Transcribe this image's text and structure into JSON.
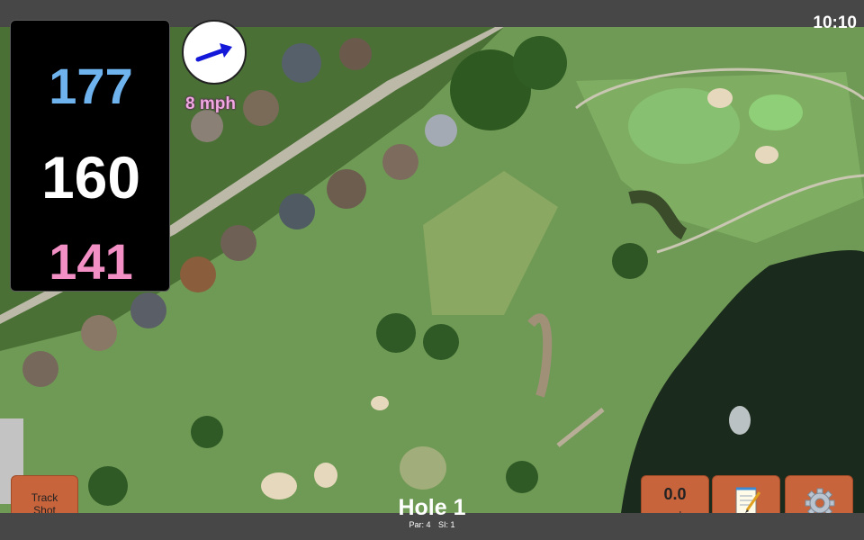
{
  "status": {
    "time": "10:10"
  },
  "distances": {
    "back": "177",
    "middle": "160",
    "front": "141"
  },
  "wind": {
    "speed": "8 mph",
    "direction_icon": "arrow-right-icon"
  },
  "buttons": {
    "track_shot": "Track\nShot",
    "speed_value": "0.0",
    "speed_unit": "mph",
    "notes_icon": "notepad-icon",
    "settings_icon": "gear-icon"
  },
  "hole": {
    "title": "Hole 1",
    "par": "Par: 4",
    "si": "SI: 1"
  },
  "colors": {
    "back": "#6eb3ee",
    "front": "#f28fc4",
    "button": "#c8643c",
    "water": "#1a2a1c"
  }
}
